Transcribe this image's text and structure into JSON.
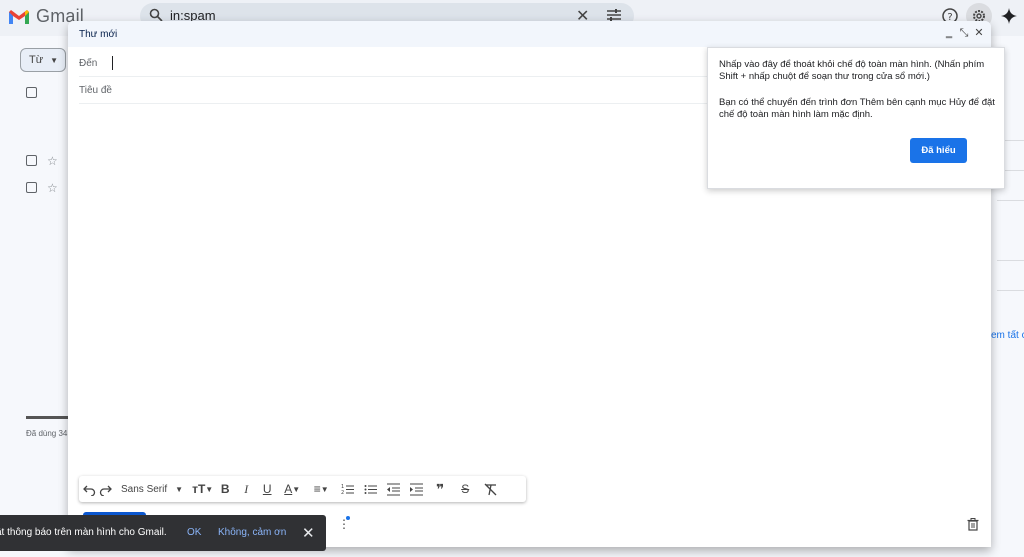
{
  "app": {
    "name": "Gmail",
    "search_query": "in:spam"
  },
  "inbox_bg": {
    "tu_label": "Từ",
    "storage_label": "Đã dùng 34",
    "right_partial_text": "em tất c"
  },
  "compose": {
    "title": "Thư mới",
    "to_label": "Đến",
    "subject_placeholder": "Tiêu đề",
    "font_name": "Sans Serif",
    "icons": [
      "undo-icon",
      "redo-icon",
      "text-size-icon",
      "bold-icon",
      "italic-icon",
      "underline-icon",
      "text-color-icon",
      "align-icon",
      "numbered-list-icon",
      "bulleted-list-icon",
      "indent-less-icon",
      "indent-more-icon",
      "quote-icon",
      "strikethrough-icon",
      "remove-formatting-icon"
    ]
  },
  "tooltip": {
    "line1": "Nhấp vào đây để thoát khỏi chế độ toàn màn hình. (Nhấn phím Shift + nhấp chuột để soạn thư trong cửa sổ mới.)",
    "line2": "Bạn có thể chuyển đến trình đơn Thêm bên cạnh mục Hủy để đặt chế độ toàn màn hình làm mặc định.",
    "button": "Đã hiểu"
  },
  "snackbar": {
    "message": "ật thông báo trên màn hình cho Gmail.",
    "ok": "OK",
    "no": "Không, cảm ơn"
  },
  "colors": {
    "accent": "#1a73e8",
    "header_bg": "#eef1f6",
    "title_bar": "#f2f6fc",
    "snackbar": "#303134"
  }
}
